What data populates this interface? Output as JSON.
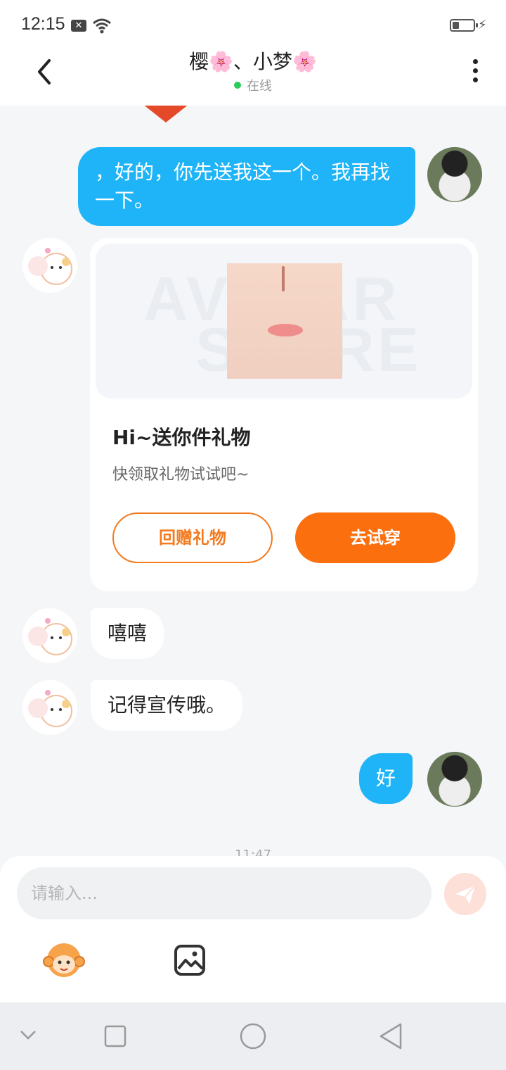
{
  "status_bar": {
    "time": "12:15",
    "notification_icon": "x-box-icon",
    "wifi_icon": "wifi-icon",
    "battery_icon": "battery-low-charging-icon"
  },
  "header": {
    "title": "樱🌸、小梦🌸",
    "status": "在线",
    "back_icon": "chevron-left-icon",
    "more_icon": "more-vertical-icon"
  },
  "messages": [
    {
      "from": "self",
      "type": "text",
      "text": "，好的，你先送我这一个。我再找一下。"
    },
    {
      "from": "other",
      "type": "gift_card",
      "title": "Hi~送你件礼物",
      "subtitle": "快领取礼物试试吧~",
      "watermark_line1": "AVATAR",
      "watermark_line2": "STORE",
      "secondary_button": "回赠礼物",
      "primary_button": "去试穿"
    },
    {
      "from": "other",
      "type": "text",
      "text": "嘻嘻"
    },
    {
      "from": "other",
      "type": "text",
      "text": "记得宣传哦。"
    },
    {
      "from": "self",
      "type": "text",
      "text": "好"
    }
  ],
  "timestamp": "11:47",
  "composer": {
    "placeholder": "请输入...",
    "send_icon": "send-icon",
    "emoji_icon": "monkey-emoji-icon",
    "image_icon": "image-icon"
  },
  "nav_bar": {
    "items": [
      "chevron-down-icon",
      "square-icon",
      "circle-icon",
      "triangle-back-icon"
    ]
  },
  "colors": {
    "self_bubble": "#1eb4f7",
    "accent_orange": "#fb6f0e",
    "online_dot": "#2dcb5b"
  }
}
